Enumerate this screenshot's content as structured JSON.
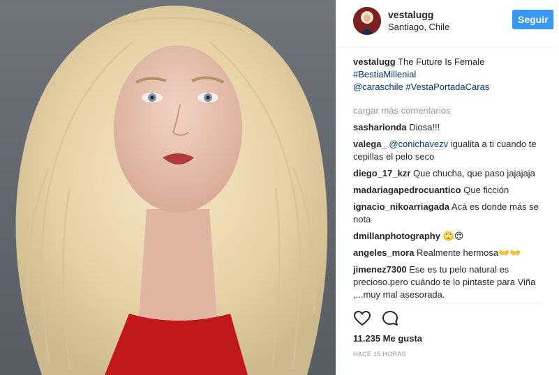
{
  "post": {
    "username": "vestalugg",
    "location": "Santiago, Chile",
    "follow_label": "Seguir",
    "caption": {
      "username": "vestalugg",
      "text": " The Future Is Female",
      "hashtag1": "#BestiaMillenial",
      "mention": "@caraschile",
      "hashtag2": "#VestaPortadaCaras"
    },
    "load_more": "cargar más comentarios",
    "comments": [
      {
        "user": "sasharionda",
        "text": " Diosa!!!"
      },
      {
        "user": "valega_",
        "mention": "@conichavezv",
        "text": " igualita a ti cuando te cepillas el pelo seco"
      },
      {
        "user": "diego_17_kzr",
        "text": " Que chucha, que paso jajajaja"
      },
      {
        "user": "madariagapedrocuantico",
        "text": " Que ficción"
      },
      {
        "user": "ignacio_nikoarriagada",
        "text": " Acá es donde más se nota"
      },
      {
        "user": "dmillanphotography",
        "text": " 🙄😍"
      },
      {
        "user": "angeles_mora",
        "text": " Realmente hermosa👐👐"
      },
      {
        "user": "jimenez7300",
        "text": " Ese es tu pelo natural es precioso.pero cuándo te lo pintaste para Viña ,...muy mal asesorada."
      }
    ],
    "likes": "11.235 Me gusta",
    "time": "HACE 15 HORAS"
  },
  "icons": {
    "like": "heart-icon",
    "comment": "comment-bubble-icon"
  },
  "colors": {
    "follow_button": "#3897f0",
    "link": "#003569",
    "muted": "#999999"
  }
}
